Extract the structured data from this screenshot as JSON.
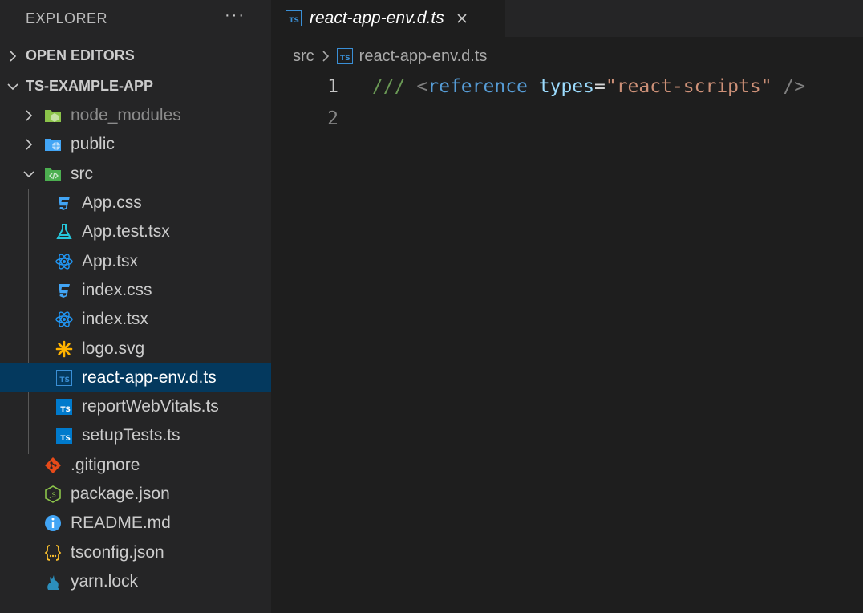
{
  "sidebar": {
    "title": "EXPLORER",
    "more": "···",
    "sections": {
      "open_editors": "OPEN EDITORS",
      "project": "TS-EXAMPLE-APP"
    },
    "tree": {
      "node_modules": "node_modules",
      "public": "public",
      "src": "src",
      "src_files": {
        "app_css": "App.css",
        "app_test": "App.test.tsx",
        "app_tsx": "App.tsx",
        "index_css": "index.css",
        "index_tsx": "index.tsx",
        "logo_svg": "logo.svg",
        "react_app_env": "react-app-env.d.ts",
        "report_web_vitals": "reportWebVitals.ts",
        "setup_tests": "setupTests.ts"
      },
      "root_files": {
        "gitignore": ".gitignore",
        "package_json": "package.json",
        "readme": "README.md",
        "tsconfig": "tsconfig.json",
        "yarn_lock": "yarn.lock"
      }
    }
  },
  "tab": {
    "label": "react-app-env.d.ts",
    "icon_text": "TS"
  },
  "breadcrumb": {
    "folder": "src",
    "file": "react-app-env.d.ts"
  },
  "editor": {
    "line_numbers": [
      "1",
      "2"
    ],
    "line1": {
      "comment": "///",
      "open": "<",
      "tag": "reference",
      "attr": "types",
      "eq": "=",
      "value": "\"react-scripts\"",
      "close": "/>"
    }
  },
  "colors": {
    "sidebar_bg": "#252526",
    "editor_bg": "#1e1e1e",
    "selection": "#04395e",
    "ts_blue": "#007acc"
  },
  "icons": {
    "ts": "typescript-icon",
    "css": "css-icon",
    "react": "react-icon",
    "test": "flask-icon",
    "svg": "svg-star-icon",
    "git": "git-icon",
    "json": "nodejs-icon",
    "info": "info-icon",
    "braces": "json-braces-icon",
    "yarn": "yarn-cat-icon"
  }
}
